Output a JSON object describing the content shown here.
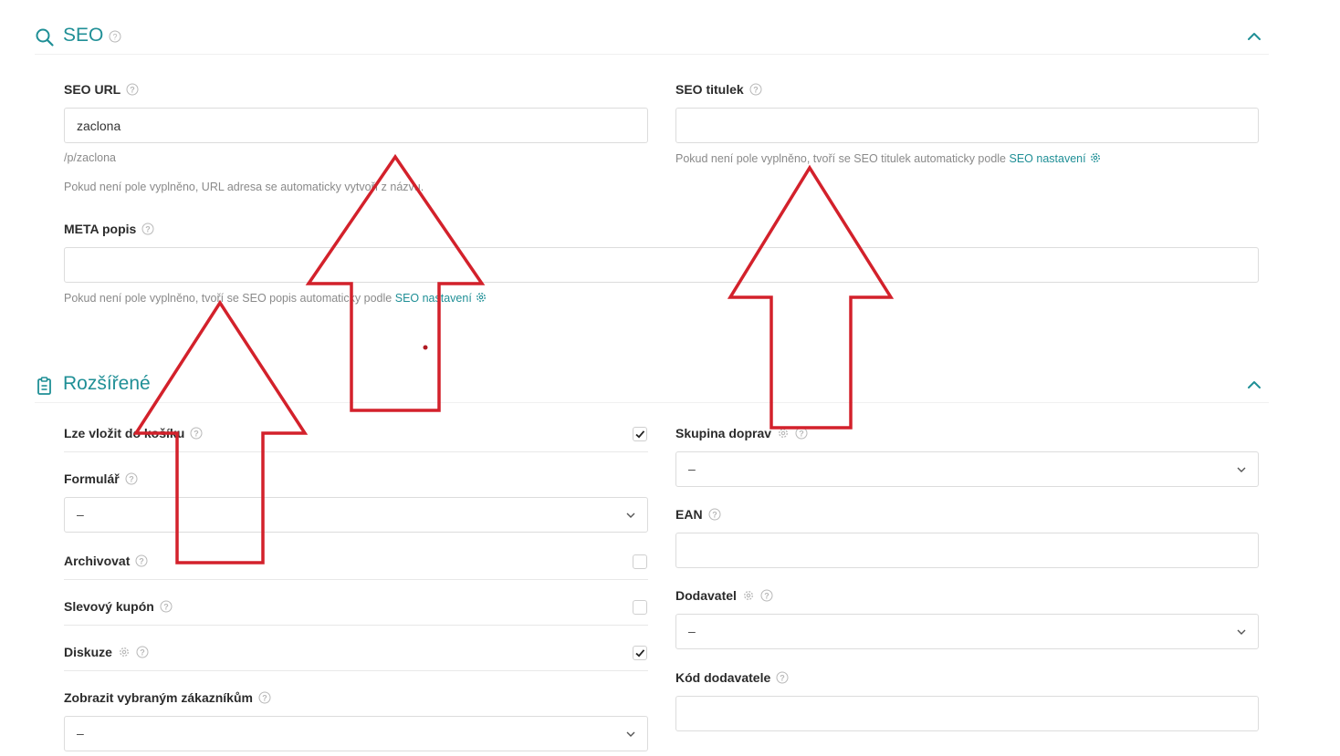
{
  "seo": {
    "title": "SEO",
    "url_label": "SEO URL",
    "url_value": "zaclona",
    "url_path": "/p/zaclona",
    "url_hint": "Pokud není pole vyplněno, URL adresa se automaticky vytvoří z názvu.",
    "title_label": "SEO titulek",
    "title_value": "",
    "title_hint": "Pokud není pole vyplněno, tvoří se SEO titulek automaticky podle",
    "title_hint_link": "SEO nastavení",
    "meta_label": "META popis",
    "meta_value": "",
    "meta_hint": "Pokud není pole vyplněno, tvoří se SEO popis automaticky podle",
    "meta_hint_link": "SEO nastavení"
  },
  "extended": {
    "title": "Rozšířené",
    "cart_label": "Lze vložit do košíku",
    "cart_checked": true,
    "form_label": "Formulář",
    "form_value": "–",
    "archive_label": "Archivovat",
    "archive_checked": false,
    "coupon_label": "Slevový kupón",
    "coupon_checked": false,
    "discussion_label": "Diskuze",
    "discussion_checked": true,
    "customers_label": "Zobrazit vybraným zákazníkům",
    "customers_value": "–",
    "shipping_label": "Skupina doprav",
    "shipping_value": "–",
    "ean_label": "EAN",
    "ean_value": "",
    "supplier_label": "Dodavatel",
    "supplier_value": "–",
    "supplier_code_label": "Kód dodavatele",
    "supplier_code_value": ""
  },
  "colors": {
    "accent": "#1f8f96",
    "annotation": "#d3212b"
  },
  "icons": {
    "seo_section": "search-icon",
    "extended_section": "clipboard-icon",
    "collapse": "chevron-up-icon",
    "help": "question-circle-icon",
    "settings": "gear-icon",
    "dropdown": "chevron-down-icon",
    "checked": "checkmark-icon"
  }
}
